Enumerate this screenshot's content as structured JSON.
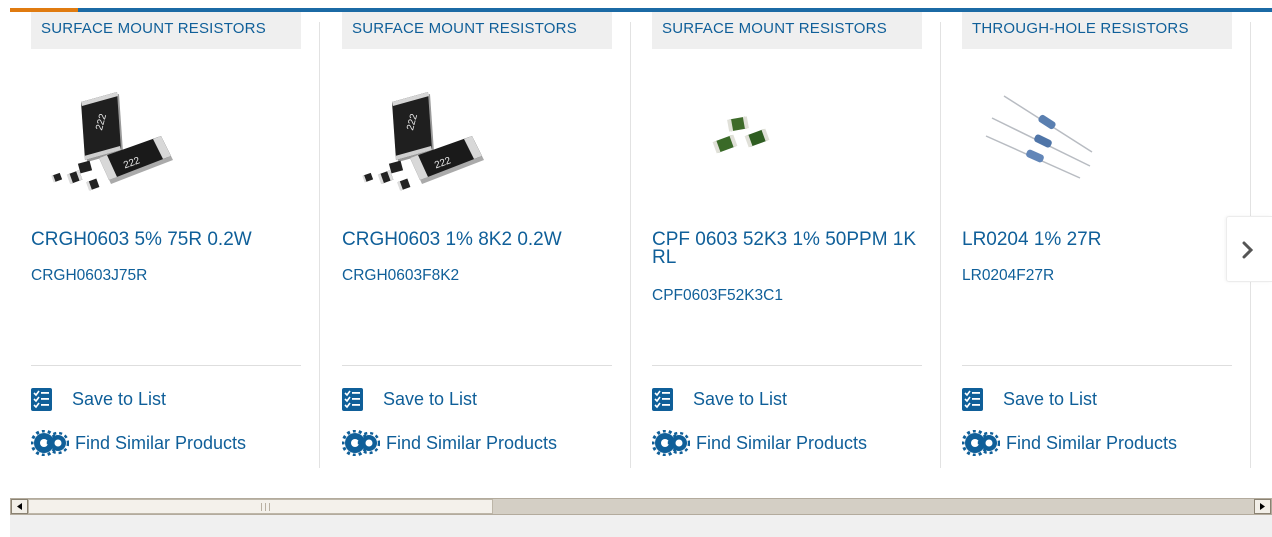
{
  "products": [
    {
      "category": "SURFACE MOUNT RESISTORS",
      "title": "CRGH0603 5% 75R 0.2W",
      "part_number": "CRGH0603J75R",
      "image_icon": "smd-chip-resistors-image"
    },
    {
      "category": "SURFACE MOUNT RESISTORS",
      "title": "CRGH0603 1% 8K2 0.2W",
      "part_number": "CRGH0603F8K2",
      "image_icon": "smd-chip-resistors-image"
    },
    {
      "category": "SURFACE MOUNT RESISTORS",
      "title": "CPF 0603 52K3 1% 50PPM 1K RL",
      "part_number": "CPF0603F52K3C1",
      "image_icon": "green-chip-resistors-image"
    },
    {
      "category": "THROUGH-HOLE RESISTORS",
      "title": "LR0204 1% 27R",
      "part_number": "LR0204F27R",
      "image_icon": "axial-resistors-image"
    }
  ],
  "actions": {
    "save_label": "Save to List",
    "similar_label": "Find Similar Products"
  },
  "carousel": {
    "next_icon": "chevron-right-icon"
  },
  "colors": {
    "link_blue": "#0f5f99",
    "top_bar_blue": "#1b6aa5",
    "accent_orange": "#e07b10",
    "category_bg": "#efefef"
  }
}
